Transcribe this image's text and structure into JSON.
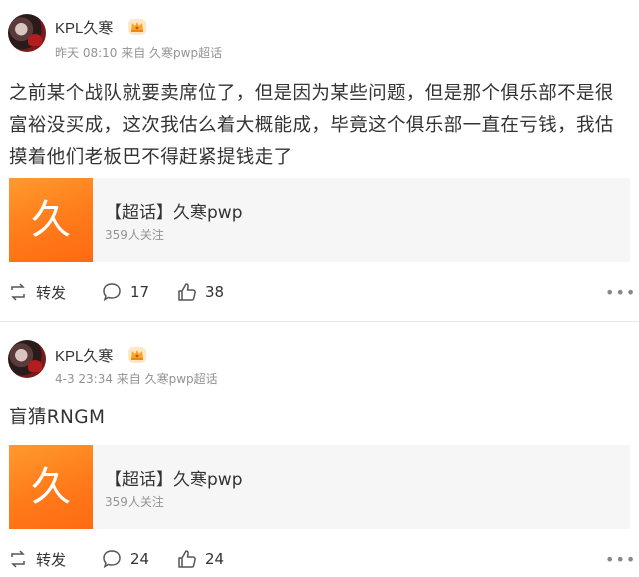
{
  "posts": [
    {
      "author": "KPL久寒",
      "meta": "昨天 08:10 来自 久寒pwp超话",
      "content": "之前某个战队就要卖席位了，但是因为某些问题，但是那个俱乐部不是很富裕没买成，这次我估么着大概能成，毕竟这个俱乐部一直在亏钱，我估摸着他们老板巴不得赶紧提钱走了",
      "card": {
        "thumb_text": "久",
        "title": "【超话】久寒pwp",
        "subtitle": "359人关注"
      },
      "actions": {
        "repost_label": "转发",
        "comments": "17",
        "likes": "38"
      }
    },
    {
      "author": "KPL久寒",
      "meta": "4-3 23:34 来自 久寒pwp超话",
      "content": "盲猜RNGM",
      "card": {
        "thumb_text": "久",
        "title": "【超话】久寒pwp",
        "subtitle": "359人关注"
      },
      "actions": {
        "repost_label": "转发",
        "comments": "24",
        "likes": "24"
      }
    }
  ],
  "icons": {
    "repost": "repost-icon",
    "comment": "comment-icon",
    "like": "like-icon",
    "more": "more-icon",
    "badge": "crown-badge-icon"
  },
  "colors": {
    "accent": "#ff7a1a",
    "meta": "#939393",
    "badge_bg": "#fde7c7"
  }
}
